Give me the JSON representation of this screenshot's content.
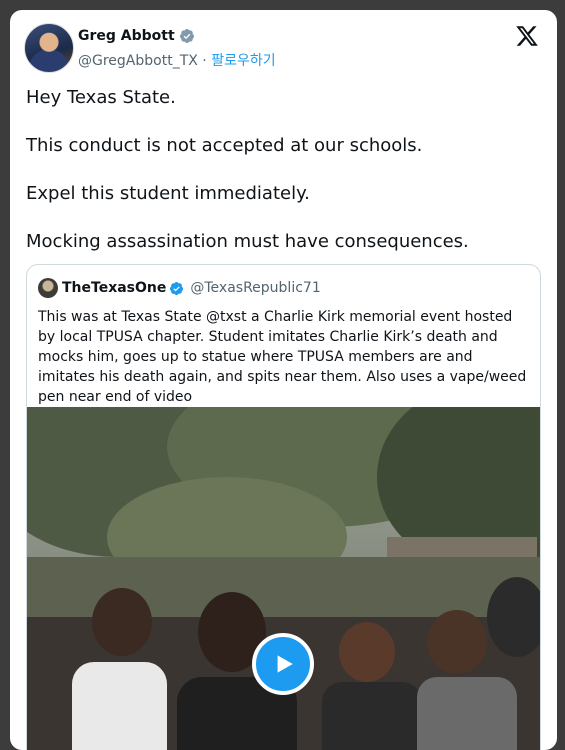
{
  "author": {
    "name": "Greg Abbott",
    "handle": "@GregAbbott_TX",
    "separator": " · ",
    "follow_label": "팔로우하기"
  },
  "tweet": {
    "lines": [
      "Hey Texas State.",
      "This conduct is not accepted at our schools.",
      "Expel this student immediately.",
      "Mocking assassination must have consequences."
    ]
  },
  "quote": {
    "name": "TheTexasOne",
    "handle": "@TexasRepublic71",
    "text": "This was at Texas State @txst a Charlie Kirk memorial event hosted by local TPUSA chapter. Student imitates Charlie Kirk’s death and mocks him, goes up to statue where TPUSA members are and imitates his death again, and spits near them. Also uses a vape/weed pen near end of video"
  },
  "icons": {
    "verified": "verified-badge-icon",
    "close": "x-logo-icon",
    "play": "play-icon"
  },
  "colors": {
    "accent": "#1d9bf0",
    "text": "#0f1419",
    "secondary": "#536471"
  }
}
